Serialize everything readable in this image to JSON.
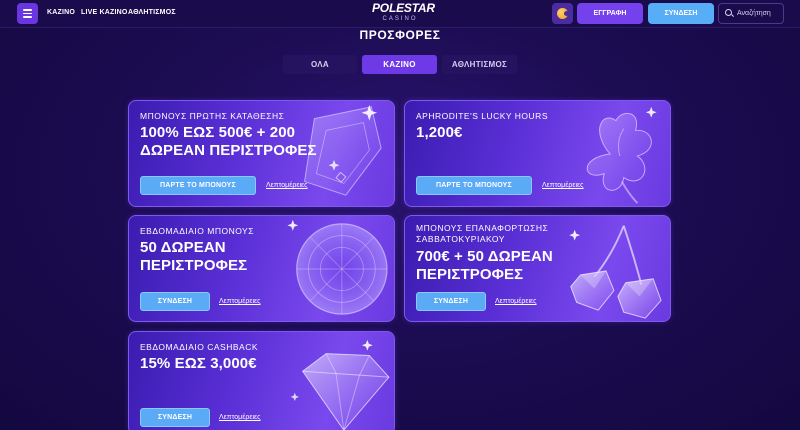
{
  "header": {
    "menu_icon": "hamburger-icon",
    "nav": [
      "ΚΑΖΙΝΟ",
      "LIVE ΚΑΖΙΝΟ",
      "ΑΘΛΗΤΙΣΜΟΣ"
    ],
    "logo_main": "POLESTAR",
    "logo_sub": "CASINO",
    "coin_icon": "coin-icon",
    "register_label": "ΕΓΓΡΑΦΗ",
    "login_label": "ΣΥΝΔΕΣΗ",
    "search_placeholder": "Αναζήτηση"
  },
  "page": {
    "title": "ΠΡΟΣΦΟΡΕΣ",
    "tabs": [
      {
        "label": "ΟΛΑ",
        "active": false
      },
      {
        "label": "ΚΑΖΙΝΟ",
        "active": true
      },
      {
        "label": "ΑΘΛΗΤΙΣΜΟΣ",
        "active": false
      }
    ]
  },
  "promos": [
    {
      "subtitle": "ΜΠΟΝΟΥΣ ΠΡΩΤΗΣ ΚΑΤΑΘΕΣΗΣ",
      "title_lines": [
        "100% ΕΩΣ 500€ + 200",
        "ΔΩΡΕΑΝ ΠΕΡΙΣΤΡΟΦΕΣ"
      ],
      "button": "ΠΑΡΤΕ ΤΟ ΜΠΟΝΟΥΣ",
      "link": "Λεπτομέρειες",
      "art": "glass-card-icon"
    },
    {
      "subtitle": "APHRODITE'S LUCKY HOURS",
      "title_lines": [
        "1,200€"
      ],
      "button": "ΠΑΡΤΕ ΤΟ ΜΠΟΝΟΥΣ",
      "link": "Λεπτομέρειες",
      "art": "clover-icon"
    },
    {
      "subtitle": "ΕΒΔΟΜΑΔΙΑΙΟ ΜΠΟΝΟΥΣ",
      "title_lines": [
        "50 ΔΩΡΕΑΝ",
        "ΠΕΡΙΣΤΡΟΦΕΣ"
      ],
      "button": "ΣΥΝΔΕΣΗ",
      "link": "Λεπτομέρειες",
      "art": "crystal-wheel-icon"
    },
    {
      "subtitle_lines": [
        "ΜΠΟΝΟΥΣ ΕΠΑΝΑΦΟΡΤΩΣΗΣ",
        "ΣΑΒΒΑΤΟΚΥΡΙΑΚΟΥ"
      ],
      "title_lines": [
        "700€ + 50 ΔΩΡΕΑΝ",
        "ΠΕΡΙΣΤΡΟΦΕΣ"
      ],
      "button": "ΣΥΝΔΕΣΗ",
      "link": "Λεπτομέρειες",
      "art": "cherries-icon"
    },
    {
      "subtitle": "ΕΒΔΟΜΑΔΙΑΙΟ CASHBACK",
      "title_lines": [
        "15% ΕΩΣ 3,000€"
      ],
      "button": "ΣΥΝΔΕΣΗ",
      "link": "Λεπτομέρειες",
      "art": "diamond-icon"
    }
  ],
  "colors": {
    "background": "#1c0c52",
    "accent_purple": "#6e3ae8",
    "accent_blue": "#57aef6"
  }
}
